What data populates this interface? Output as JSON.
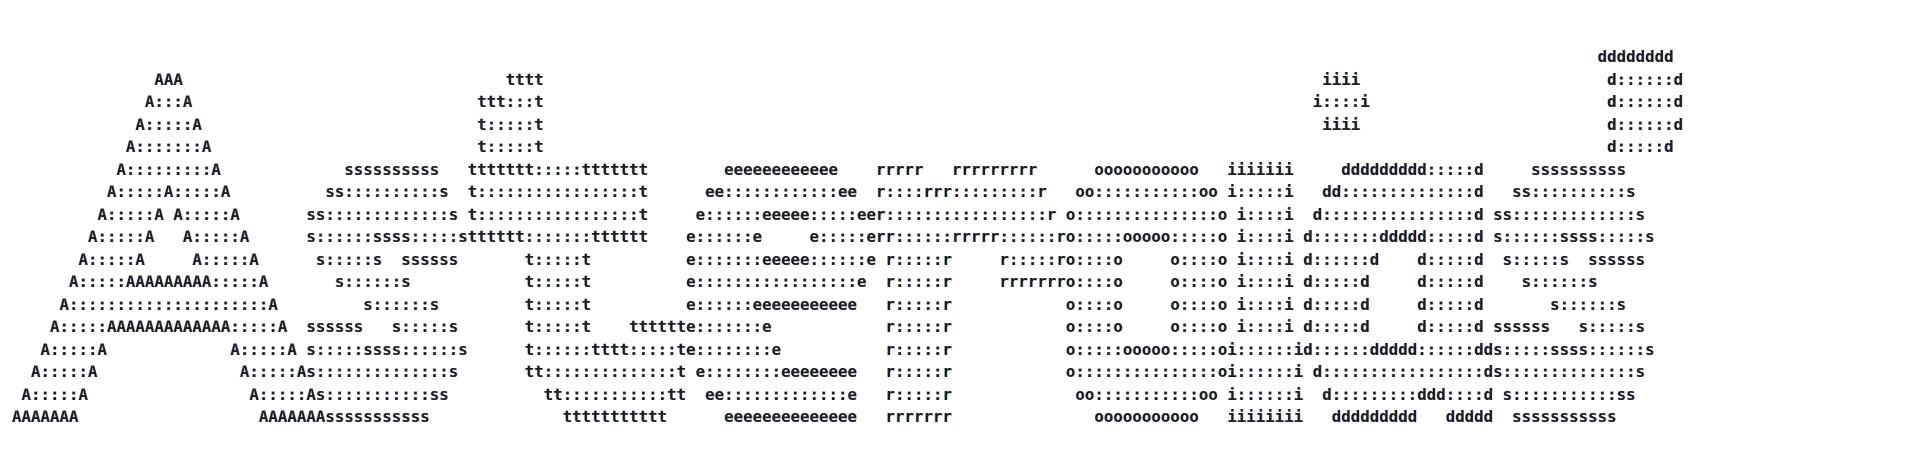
{
  "banner": {
    "lines": [
      "                                                                                                                                                                       dddddddd",
      "               AAA                                  tttt                                                                                  iiii                          d::::::d",
      "              A:::A                              ttt:::t                                                                                 i::::i                         d::::::d",
      "             A:::::A                             t:::::t                                                                                  iiii                          d::::::d",
      "            A:::::::A                            t:::::t                                                                                                                d:::::d",
      "           A:::::::::A             ssssssssss   ttttttt:::::ttttttt        eeeeeeeeeeee    rrrrr   rrrrrrrrr      ooooooooooo   iiiiiii     ddddddddd:::::d     ssssssssss",
      "          A:::::A:::::A          ss::::::::::s  t:::::::::::::::::t      ee::::::::::::ee  r::::rrr:::::::::r   oo:::::::::::oo i:::::i   dd::::::::::::::d   ss::::::::::s",
      "         A:::::A A:::::A       ss:::::::::::::s t:::::::::::::::::t     e::::::eeeee:::::eer:::::::::::::::::r o:::::::::::::::o i::::i  d::::::::::::::::d ss:::::::::::::s",
      "        A:::::A   A:::::A      s::::::ssss:::::stttttt:::::::tttttt    e::::::e     e:::::err::::::rrrrr::::::ro:::::ooooo:::::o i::::i d:::::::ddddd:::::d s::::::ssss:::::s",
      "       A:::::A     A:::::A      s:::::s  ssssss       t:::::t          e:::::::eeeee::::::e r:::::r     r:::::ro::::o     o::::o i::::i d::::::d    d:::::d  s:::::s  ssssss",
      "      A:::::AAAAAAAAA:::::A       s::::::s            t:::::t          e:::::::::::::::::e  r:::::r     rrrrrrro::::o     o::::o i::::i d:::::d     d:::::d    s::::::s",
      "     A:::::::::::::::::::::A         s::::::s         t:::::t          e::::::eeeeeeeeeee   r:::::r            o::::o     o::::o i::::i d:::::d     d:::::d       s::::::s",
      "    A:::::AAAAAAAAAAAAA:::::A  ssssss   s:::::s       t:::::t    tttttte:::::::e            r:::::r            o::::o     o::::o i::::i d:::::d     d:::::d ssssss   s:::::s",
      "   A:::::A             A:::::A s:::::ssss::::::s      t::::::tttt:::::te::::::::e           r:::::r            o:::::ooooo:::::oi::::::id::::::ddddd::::::dds:::::ssss::::::s",
      "  A:::::A               A:::::As::::::::::::::s       tt::::::::::::::t e::::::::eeeeeeee   r:::::r            o:::::::::::::::oi::::::i d:::::::::::::::::ds::::::::::::::s",
      " A:::::A                 A:::::As:::::::::::ss          tt:::::::::::tt  ee:::::::::::::e   r:::::r             oo:::::::::::oo i::::::i  d:::::::::ddd::::d s:::::::::::ss",
      "AAAAAAA                   AAAAAAAsssssssssss              ttttttttttt      eeeeeeeeeeeeee   rrrrrrr               ooooooooooo   iiiiiiii   ddddddddd   ddddd  sssssssssss"
    ]
  }
}
